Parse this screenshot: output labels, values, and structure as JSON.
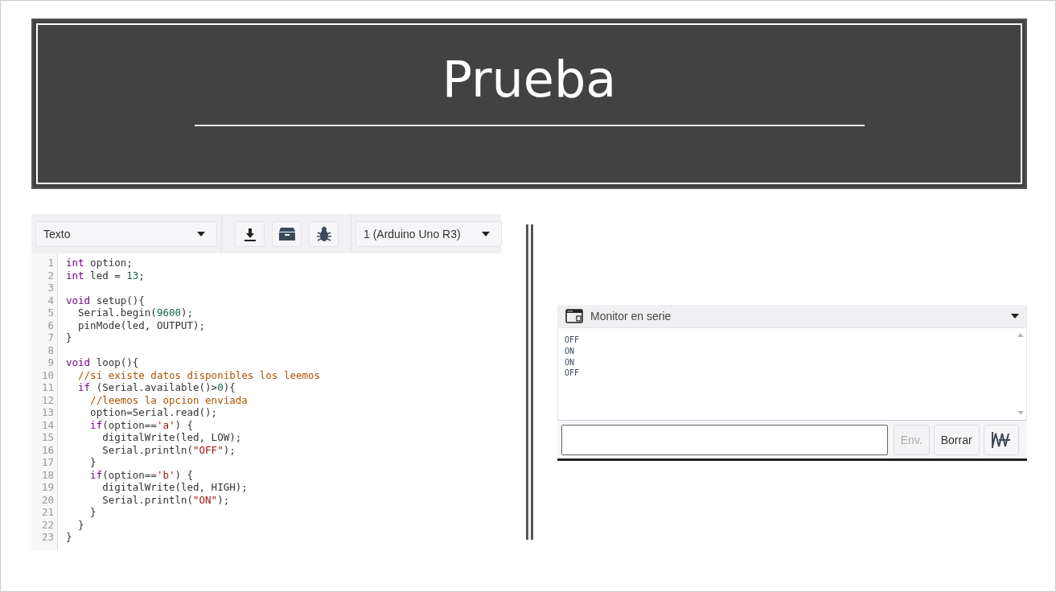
{
  "title": "Prueba",
  "editor": {
    "mode_select": "Texto",
    "toolbar": [
      {
        "kind": "download"
      },
      {
        "kind": "box"
      },
      {
        "kind": "bug"
      }
    ],
    "board_select": "1 (Arduino Uno R3)",
    "lines": [
      {
        "n": "1",
        "tokens": [
          {
            "t": "int",
            "kind": "keyword"
          },
          {
            "t": " option;",
            "kind": "plain"
          }
        ]
      },
      {
        "n": "2",
        "tokens": [
          {
            "t": "int",
            "kind": "keyword"
          },
          {
            "t": " led = ",
            "kind": "plain"
          },
          {
            "t": "13",
            "kind": "number"
          },
          {
            "t": ";",
            "kind": "plain"
          }
        ]
      },
      {
        "n": "3"
      },
      {
        "n": "4",
        "tokens": [
          {
            "t": "void",
            "kind": "keyword"
          },
          {
            "t": " setup(){",
            "kind": "plain"
          }
        ]
      },
      {
        "n": "5",
        "tokens": [
          {
            "t": "  Serial.begin(",
            "kind": "plain"
          },
          {
            "t": "9600",
            "kind": "number"
          },
          {
            "t": ");",
            "kind": "plain"
          }
        ]
      },
      {
        "n": "6",
        "tokens": [
          {
            "t": "  pinMode(led, OUTPUT);",
            "kind": "plain"
          }
        ]
      },
      {
        "n": "7",
        "tokens": [
          {
            "t": "}",
            "kind": "plain"
          }
        ]
      },
      {
        "n": "8"
      },
      {
        "n": "9",
        "tokens": [
          {
            "t": "void",
            "kind": "keyword"
          },
          {
            "t": " loop(){",
            "kind": "plain"
          }
        ]
      },
      {
        "n": "10",
        "tokens": [
          {
            "t": "  //si existe datos disponibles los leemos",
            "kind": "comment"
          }
        ]
      },
      {
        "n": "11",
        "tokens": [
          {
            "t": "  if",
            "kind": "keyword"
          },
          {
            "t": " (Serial.available()>",
            "kind": "plain"
          },
          {
            "t": "0",
            "kind": "number"
          },
          {
            "t": "){",
            "kind": "plain"
          }
        ]
      },
      {
        "n": "12",
        "tokens": [
          {
            "t": "    //leemos la opcion enviada",
            "kind": "comment"
          }
        ]
      },
      {
        "n": "13",
        "tokens": [
          {
            "t": "    option=Serial.read();",
            "kind": "plain"
          }
        ]
      },
      {
        "n": "14",
        "tokens": [
          {
            "t": "    if",
            "kind": "keyword"
          },
          {
            "t": "(option==",
            "kind": "plain"
          },
          {
            "t": "'a'",
            "kind": "string"
          },
          {
            "t": ") {",
            "kind": "plain"
          }
        ]
      },
      {
        "n": "15",
        "tokens": [
          {
            "t": "      digitalWrite(led, LOW);",
            "kind": "plain"
          }
        ]
      },
      {
        "n": "16",
        "tokens": [
          {
            "t": "      Serial.println(",
            "kind": "plain"
          },
          {
            "t": "\"OFF\"",
            "kind": "string"
          },
          {
            "t": ");",
            "kind": "plain"
          }
        ]
      },
      {
        "n": "17",
        "tokens": [
          {
            "t": "    }",
            "kind": "plain"
          }
        ]
      },
      {
        "n": "18",
        "tokens": [
          {
            "t": "    if",
            "kind": "keyword"
          },
          {
            "t": "(option==",
            "kind": "plain"
          },
          {
            "t": "'b'",
            "kind": "string"
          },
          {
            "t": ") {",
            "kind": "plain"
          }
        ]
      },
      {
        "n": "19",
        "tokens": [
          {
            "t": "      digitalWrite(led, HIGH);",
            "kind": "plain"
          }
        ]
      },
      {
        "n": "20",
        "tokens": [
          {
            "t": "      Serial.println(",
            "kind": "plain"
          },
          {
            "t": "\"ON\"",
            "kind": "string"
          },
          {
            "t": ");",
            "kind": "plain"
          }
        ]
      },
      {
        "n": "21",
        "tokens": [
          {
            "t": "    }",
            "kind": "plain"
          }
        ]
      },
      {
        "n": "22",
        "tokens": [
          {
            "t": "  }",
            "kind": "plain"
          }
        ]
      },
      {
        "n": "23",
        "tokens": [
          {
            "t": "}",
            "kind": "plain"
          }
        ]
      }
    ]
  },
  "serial_monitor": {
    "title": "Monitor en serie",
    "output": [
      "OFF",
      "ON",
      "ON",
      "OFF"
    ],
    "buttons": [
      {
        "label": "Env.",
        "disabled": true
      },
      {
        "label": "Borrar",
        "disabled": false
      }
    ]
  }
}
